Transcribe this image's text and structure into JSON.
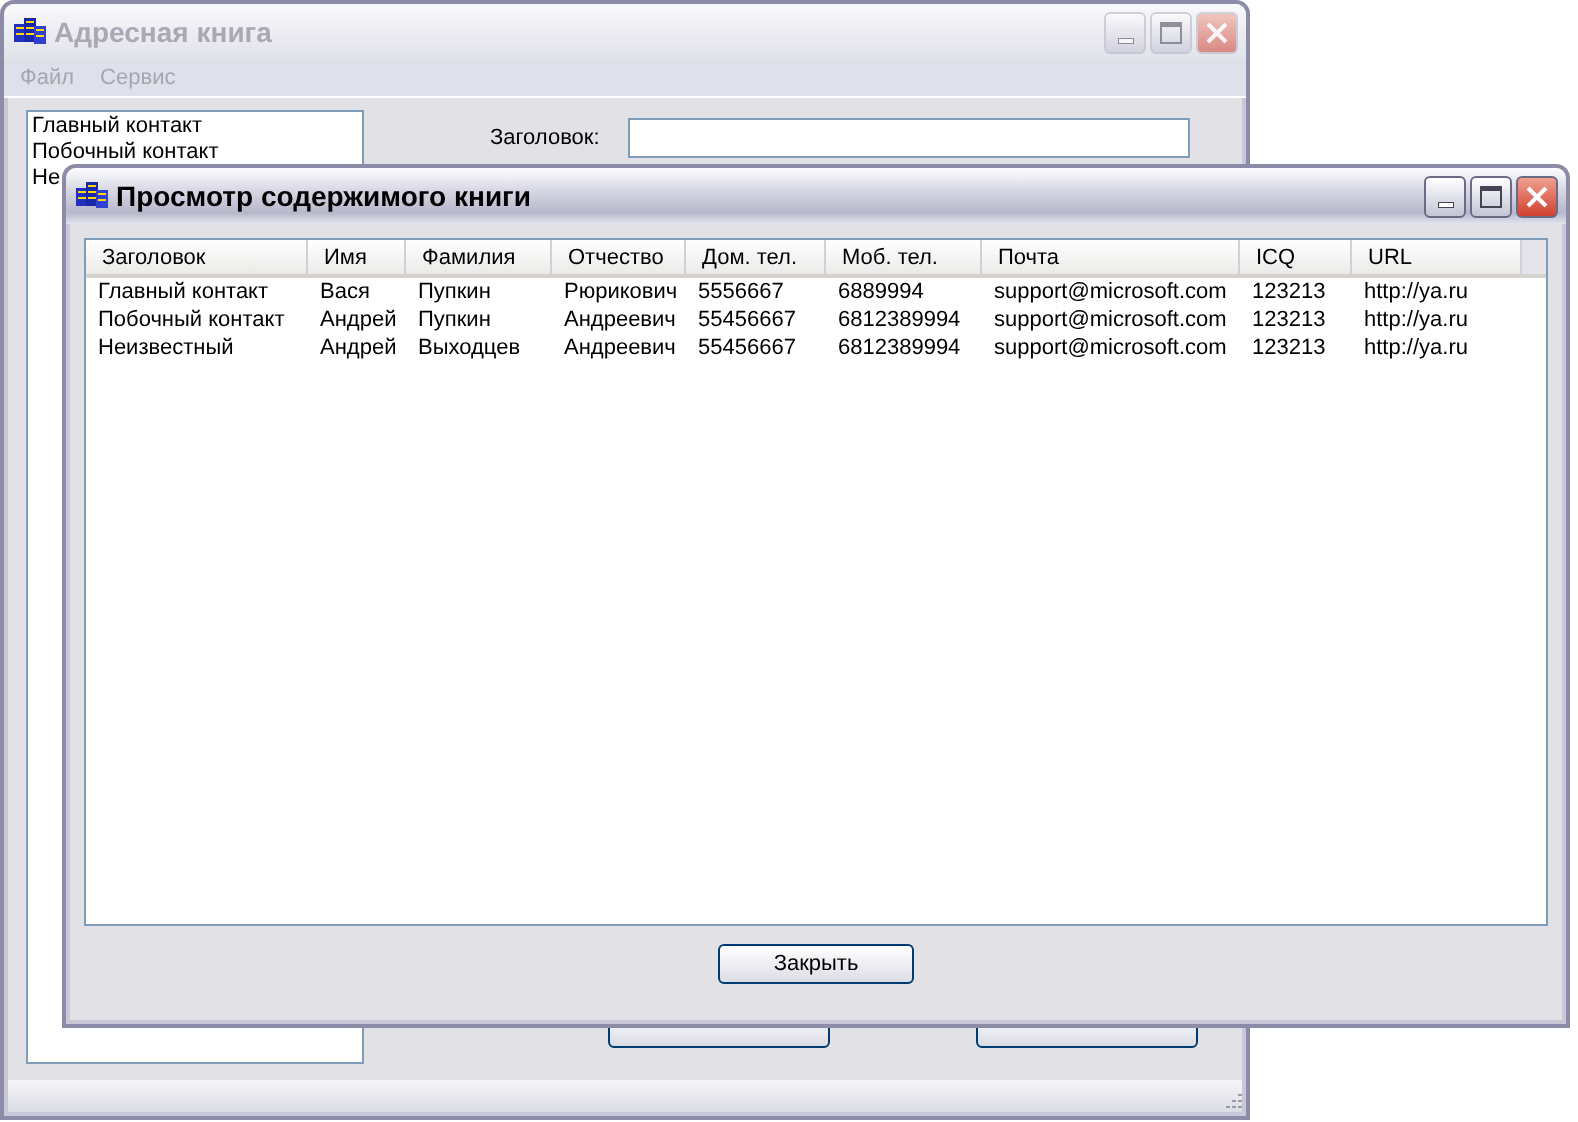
{
  "main_window": {
    "title": "Адресная книга",
    "active": false,
    "menu": [
      {
        "label": "Файл"
      },
      {
        "label": "Сервис"
      }
    ],
    "contacts": [
      {
        "label": "Главный контакт"
      },
      {
        "label": "Побочный контакт"
      },
      {
        "label": "Не"
      }
    ],
    "title_label": "Заголовок:"
  },
  "dialog": {
    "title": "Просмотр содержимого книги",
    "active": true,
    "columns": [
      "Заголовок",
      "Имя",
      "Фамилия",
      "Отчество",
      "Дом. тел.",
      "Моб. тел.",
      "Почта",
      "ICQ",
      "URL"
    ],
    "rows": [
      [
        "Главный контакт",
        "Вася",
        "Пупкин",
        "Рюрикович",
        "5556667",
        "6889994",
        "support@microsoft.com",
        "123213",
        "http://ya.ru"
      ],
      [
        "Побочный контакт",
        "Андрей",
        "Пупкин",
        "Андреевич",
        "55456667",
        "6812389994",
        "support@microsoft.com",
        "123213",
        "http://ya.ru"
      ],
      [
        "Неизвестный",
        "Андрей",
        "Выходцев",
        "Андреевич",
        "55456667",
        "6812389994",
        "support@microsoft.com",
        "123213",
        "http://ya.ru"
      ]
    ],
    "close_button": "Закрыть"
  }
}
